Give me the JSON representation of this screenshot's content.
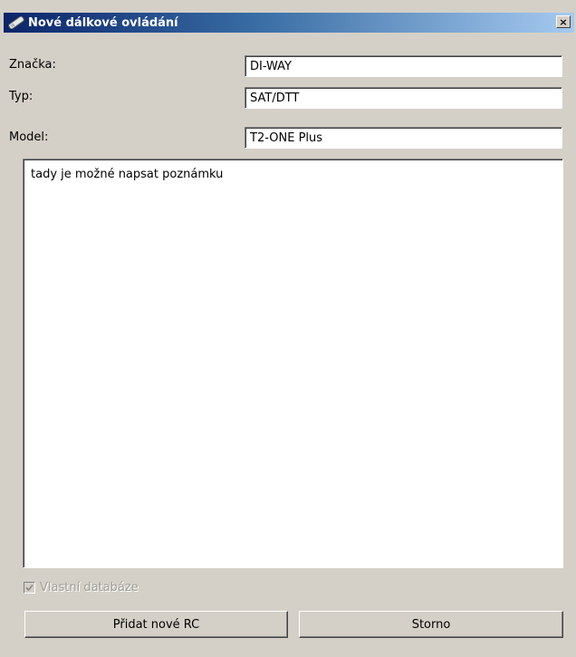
{
  "window": {
    "title": "Nové dálkové ovládání",
    "close_label": "×"
  },
  "form": {
    "brand": {
      "label": "Značka:",
      "value": "DI-WAY"
    },
    "type": {
      "label": "Typ:",
      "value": "SAT/DTT"
    },
    "model": {
      "label": "Model:",
      "value": "T2-ONE Plus"
    },
    "note": "tady je možné napsat poznámku"
  },
  "own_database": {
    "label": "Vlastní databáze",
    "checked": true,
    "disabled": true
  },
  "buttons": {
    "add": "Přidat nové RC",
    "cancel": "Storno"
  }
}
